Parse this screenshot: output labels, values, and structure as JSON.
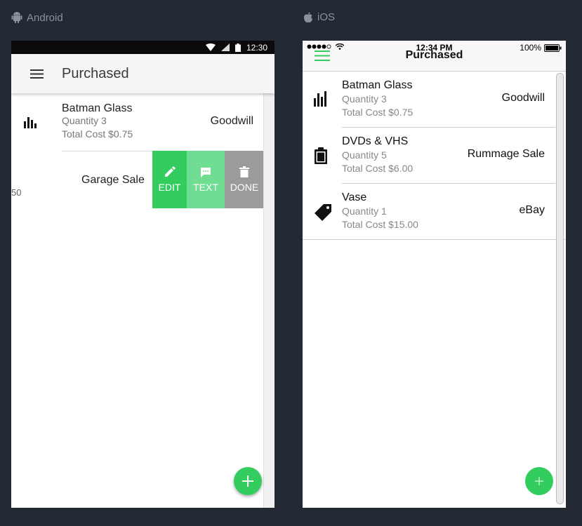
{
  "labels": {
    "android": "Android",
    "ios": "iOS"
  },
  "android": {
    "status_time": "12:30",
    "title": "Purchased",
    "items": [
      {
        "name": "Batman Glass",
        "quantity": "Quantity 3",
        "cost": "Total Cost $0.75",
        "store": "Goodwill"
      }
    ],
    "swiped_item": {
      "store": "Garage Sale",
      "leftover_text": "50"
    },
    "actions": {
      "edit": "EDIT",
      "text": "TEXT",
      "done": "DONE"
    }
  },
  "ios": {
    "status_time": "12:34 PM",
    "battery": "100%",
    "title": "Purchased",
    "items": [
      {
        "name": "Batman Glass",
        "quantity": "Quantity 3",
        "cost": "Total Cost $0.75",
        "store": "Goodwill",
        "icon": "bar-chart-icon"
      },
      {
        "name": "DVDs & VHS",
        "quantity": "Quantity 5",
        "cost": "Total Cost $6.00",
        "store": "Rummage Sale",
        "icon": "clipboard-icon"
      },
      {
        "name": "Vase",
        "quantity": "Quantity 1",
        "cost": "Total Cost $15.00",
        "store": "eBay",
        "icon": "tag-icon"
      }
    ]
  },
  "colors": {
    "background": "#232a33",
    "accent": "#33cd5f",
    "accent_light": "#6fdd92",
    "delete_grey": "#9b9b9b"
  }
}
